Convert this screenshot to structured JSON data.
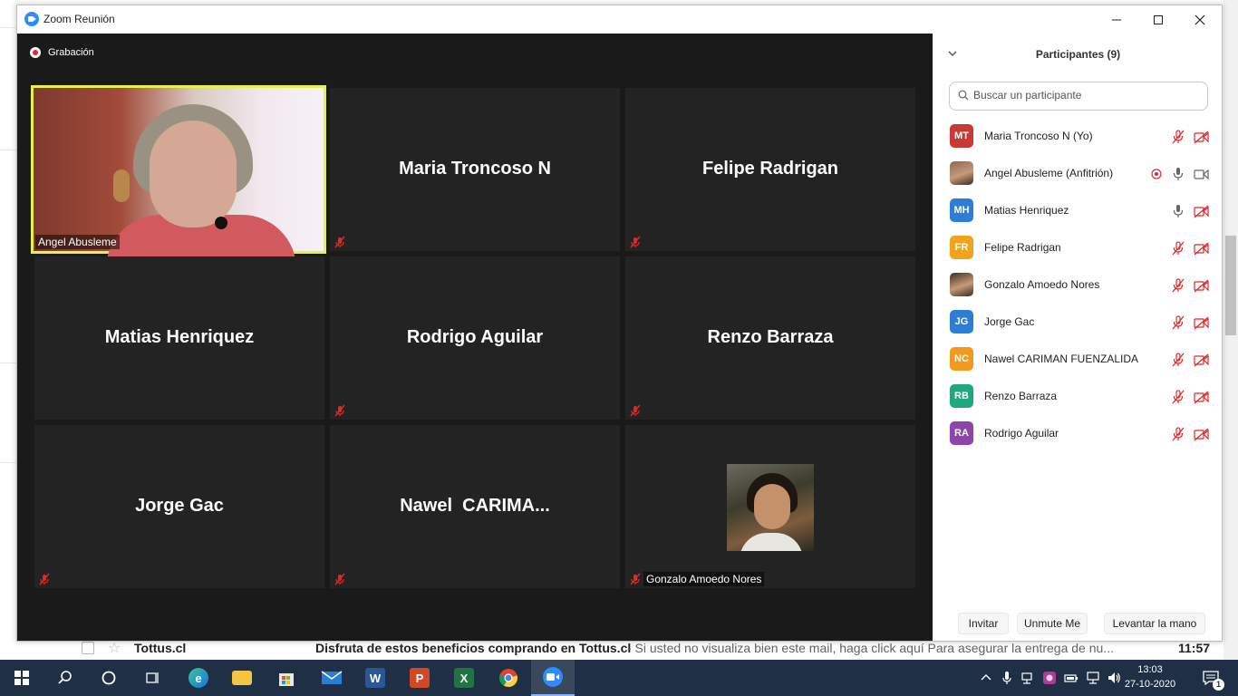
{
  "window": {
    "title": "Zoom Reunión"
  },
  "recording": {
    "label": "Grabación"
  },
  "video_tiles": [
    {
      "name": "Angel Abusleme",
      "type": "video",
      "active_speaker": true
    },
    {
      "name": "Maria Troncoso N",
      "type": "name",
      "muted": true
    },
    {
      "name": "Felipe Radrigan",
      "type": "name",
      "muted": true
    },
    {
      "name": "Matias Henriquez",
      "type": "name",
      "muted": false
    },
    {
      "name": "Rodrigo Aguilar",
      "type": "name",
      "muted": true
    },
    {
      "name": "Renzo Barraza",
      "type": "name",
      "muted": true
    },
    {
      "name": "Jorge Gac",
      "type": "name",
      "muted": true
    },
    {
      "name": "Nawel  CARIMA...",
      "type": "name",
      "muted": true
    },
    {
      "name": "Gonzalo Amoedo Nores",
      "type": "photo",
      "muted": true
    }
  ],
  "panel": {
    "title": "Participantes (9)",
    "search_placeholder": "Buscar un participante",
    "participants": [
      {
        "initials": "MT",
        "name": "Maria Troncoso N (Yo)",
        "color": "#c83a34",
        "mic": "muted",
        "video": "off"
      },
      {
        "initials": "",
        "name": "Angel Abusleme (Anfitrión)",
        "color": "#8a6a55",
        "mic": "on",
        "video": "on",
        "recording": true,
        "photo": true
      },
      {
        "initials": "MH",
        "name": "Matias Henriquez",
        "color": "#2d7cd6",
        "mic": "on",
        "video": "off"
      },
      {
        "initials": "FR",
        "name": "Felipe Radrigan",
        "color": "#f2a21b",
        "mic": "muted",
        "video": "off"
      },
      {
        "initials": "",
        "name": "Gonzalo Amoedo Nores",
        "color": "#3a3020",
        "mic": "muted",
        "video": "off",
        "photo": true
      },
      {
        "initials": "JG",
        "name": "Jorge Gac",
        "color": "#2d7cd6",
        "mic": "muted",
        "video": "off"
      },
      {
        "initials": "NC",
        "name": "Nawel CARIMAN FUENZALIDA",
        "color": "#f29a1b",
        "mic": "muted",
        "video": "off"
      },
      {
        "initials": "RB",
        "name": "Renzo Barraza",
        "color": "#1fa77e",
        "mic": "muted",
        "video": "off"
      },
      {
        "initials": "RA",
        "name": "Rodrigo Aguilar",
        "color": "#8e44ad",
        "mic": "muted",
        "video": "off"
      }
    ],
    "buttons": {
      "invite": "Invitar",
      "unmute_me": "Unmute Me",
      "raise_hand": "Levantar la mano"
    }
  },
  "background_email": {
    "sender": "Tottus.cl",
    "subject": "Disfruta de estos beneficios comprando en Tottus.cl",
    "snippet": " - Si usted no visualiza bien este mail, haga click aquí Para asegurar la entrega de nu...",
    "time": "11:57"
  },
  "taskbar": {
    "time": "13:03",
    "date": "27-10-2020",
    "notification_count": "1",
    "apps": [
      "start",
      "search",
      "cortana",
      "task-view",
      "edge",
      "file-explorer",
      "store",
      "mail",
      "word",
      "powerpoint",
      "excel",
      "chrome",
      "zoom"
    ]
  },
  "colors": {
    "speaker_border": "#e6f24a",
    "muted_red": "#e02828",
    "taskbar": "#1f2f45"
  }
}
